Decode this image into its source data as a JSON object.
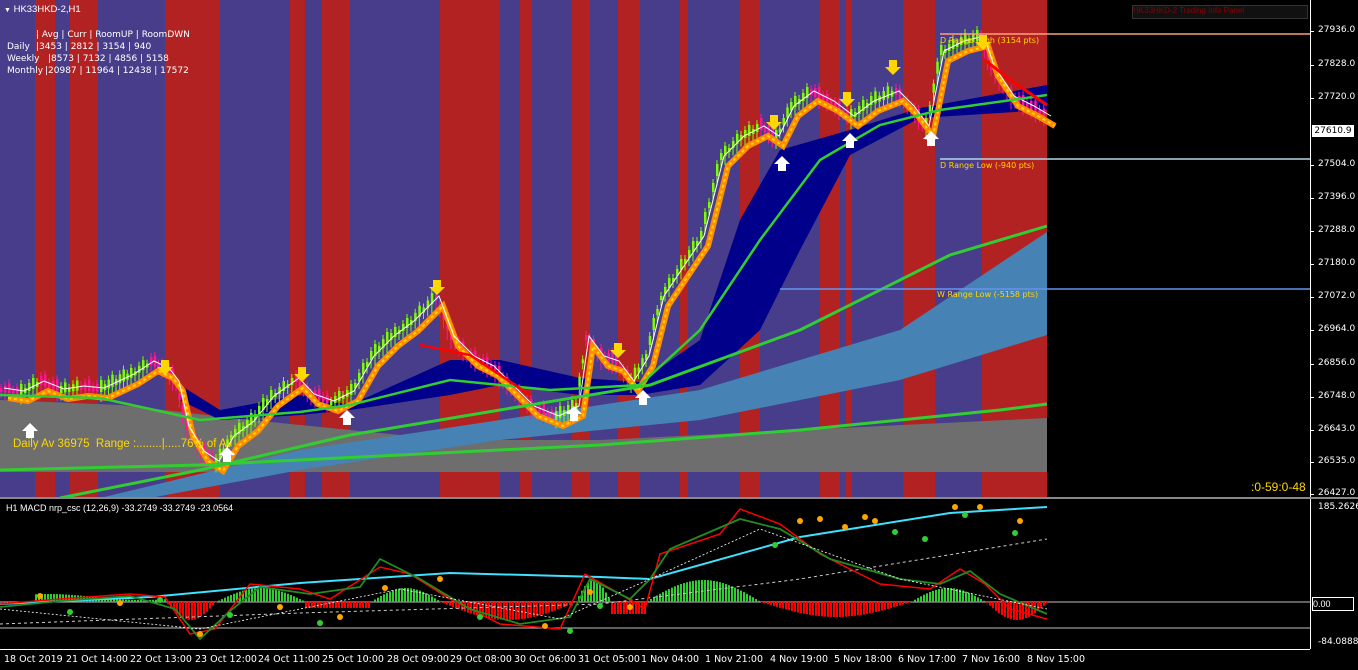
{
  "window": {
    "symbol_title": "HK33HKD-2,H1",
    "top_right_text": "HK33HKD-2 Trading Info Panel"
  },
  "info_panel": {
    "header": "| Avg | Curr | RoomUP | RoomDWN",
    "rows": [
      {
        "label": "Daily",
        "values": "|3453 | 2812 | 3154 | 940"
      },
      {
        "label": "Weekly",
        "values": "|8573 | 7132 | 4856 | 5158"
      },
      {
        "label": "Monthly",
        "values": "|20987 | 11964 | 12438 | 17572"
      }
    ]
  },
  "annotations": {
    "daily_av": "Daily Av 36975  Range :........|.....76% of Av",
    "d_range_high": "D Range High (3154 pts)",
    "d_range_low": "D Range Low (-940 pts)",
    "w_range_low": "W Range Low (-5158 pts)",
    "countdown": ":0-59:0-48"
  },
  "price_axis": {
    "labels": [
      "27936.0",
      "27828.0",
      "27720.0",
      "27504.0",
      "27396.0",
      "27288.0",
      "27180.0",
      "27072.0",
      "26964.0",
      "26856.0",
      "26748.0",
      "26643.0",
      "26535.0",
      "26427.0"
    ],
    "current_price": "27610.9"
  },
  "macd": {
    "title": "H1 MACD nrp_csc (12,26,9) -33.2749 -33.2749 -23.0564",
    "axis_labels": [
      "185.2626",
      "0.00",
      "-84.0888"
    ]
  },
  "time_axis": {
    "labels": [
      "18 Oct 2019",
      "21 Oct 14:00",
      "22 Oct 13:00",
      "23 Oct 12:00",
      "24 Oct 11:00",
      "25 Oct 10:00",
      "28 Oct 09:00",
      "29 Oct 08:00",
      "30 Oct 06:00",
      "31 Oct 05:00",
      "1 Nov 04:00",
      "1 Nov 21:00",
      "4 Nov 19:00",
      "5 Nov 18:00",
      "6 Nov 17:00",
      "7 Nov 16:00",
      "8 Nov 15:00"
    ]
  },
  "colors": {
    "zone_red": "#b22222",
    "zone_blue": "#483d8b",
    "cloud_navy": "#00008b",
    "cloud_grey": "#6e6e6e",
    "cloud_steel": "#4682b4",
    "ma_green": "#32cd32",
    "arrow_yellow": "#ffd700",
    "arrow_white": "#ffffff",
    "hist_green": "#32cd32",
    "hist_red": "#ff0000",
    "signal_cyan": "#40e0ff"
  }
}
